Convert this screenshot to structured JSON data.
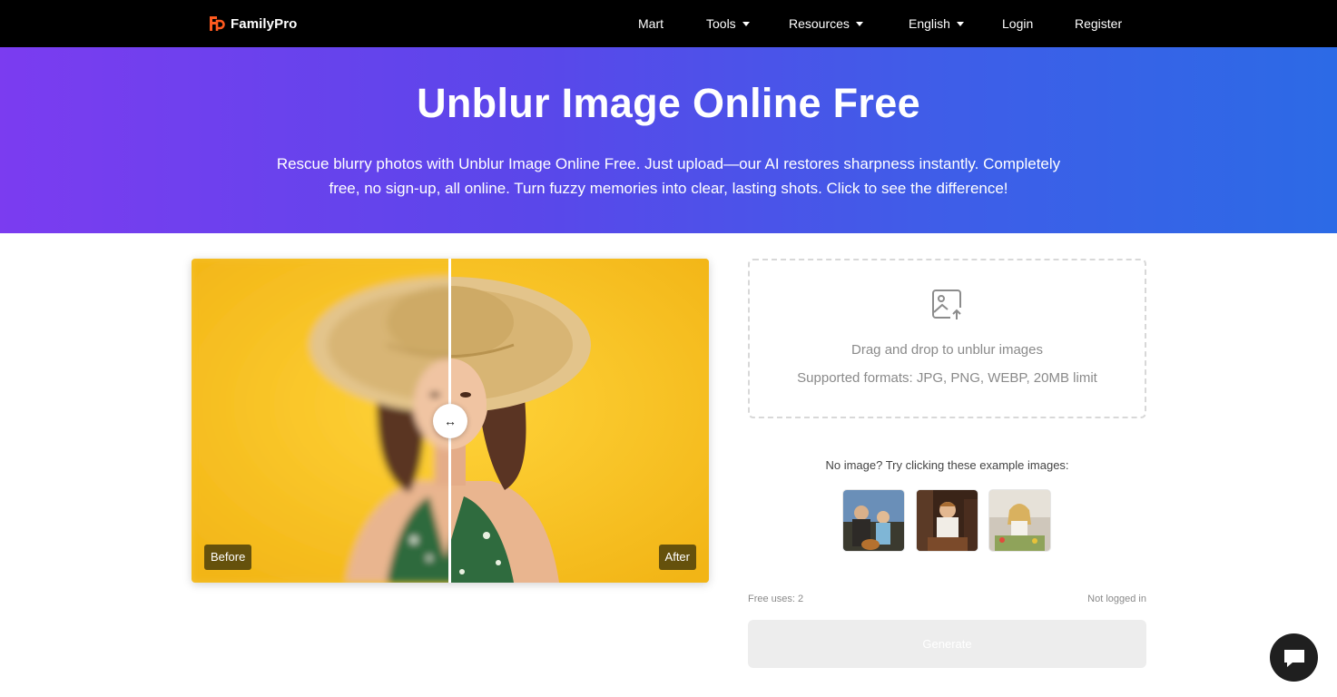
{
  "nav": {
    "logo_text": "FamilyPro",
    "items": [
      {
        "label": "Mart"
      },
      {
        "label": "Tools"
      },
      {
        "label": "Resources"
      },
      {
        "label": "English"
      },
      {
        "label": "Login"
      },
      {
        "label": "Register"
      }
    ]
  },
  "hero": {
    "title": "Unblur Image Online Free",
    "subtitle": "Rescue blurry photos with Unblur Image Online Free. Just upload—our AI restores sharpness instantly. Completely free, no sign-up, all online. Turn fuzzy memories into clear, lasting shots. Click to see the difference!"
  },
  "compare": {
    "before_label": "Before",
    "after_label": "After",
    "handle_glyph": "↔"
  },
  "upload": {
    "drop_text": "Drag and drop to unblur images",
    "formats_text": "Supported formats: JPG, PNG, WEBP, 20MB limit"
  },
  "examples": {
    "label": "No image? Try clicking these example images:"
  },
  "status": {
    "free_uses": "Free uses: 2",
    "login_state": "Not logged in"
  },
  "generate": {
    "label": "Generate"
  },
  "colors": {
    "accent_start": "#7b3cf0",
    "accent_end": "#2c6ae6",
    "nav_bg": "#000000",
    "logo_orange": "#ff5a1f"
  }
}
